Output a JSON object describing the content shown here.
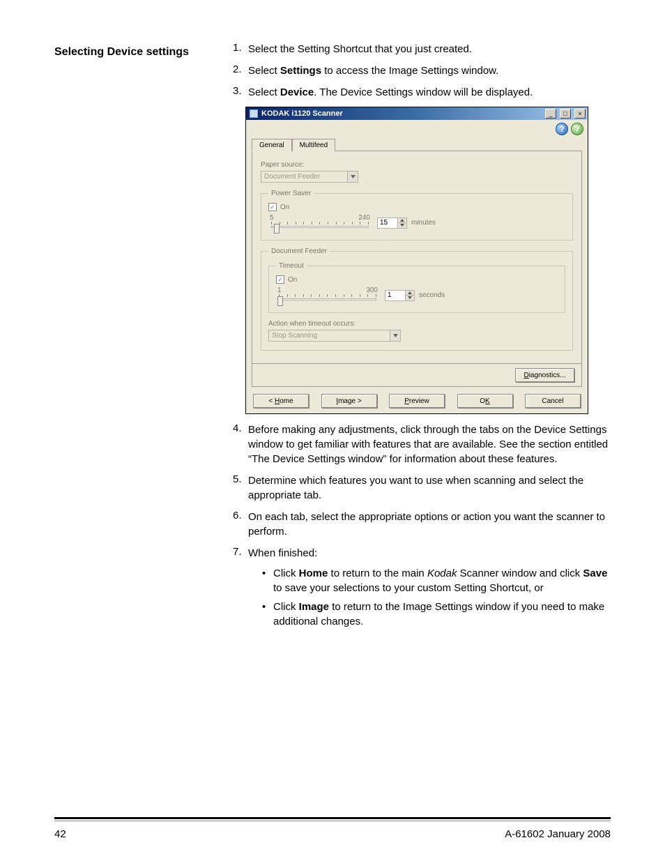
{
  "heading": "Selecting Device settings",
  "steps": {
    "s1_num": "1.",
    "s1": "Select the Setting Shortcut that you just created.",
    "s2_num": "2.",
    "s2a": "Select ",
    "s2b": "Settings",
    "s2c": " to access the Image Settings window.",
    "s3_num": "3.",
    "s3a": "Select ",
    "s3b": "Device",
    "s3c": ". The Device Settings window will be displayed.",
    "s4_num": "4.",
    "s4": "Before making any adjustments, click through the tabs on the Device Settings window to get familiar with features that are available. See the section entitled “The Device Settings window” for information about these features.",
    "s5_num": "5.",
    "s5": "Determine which features you want to use when scanning and select the appropriate tab.",
    "s6_num": "6.",
    "s6": "On each tab, select the appropriate options or action you want the scanner to perform.",
    "s7_num": "7.",
    "s7": "When finished:",
    "b1a": "Click ",
    "b1b": "Home",
    "b1c": " to return to the main ",
    "b1d": "Kodak",
    "b1e": " Scanner window and click ",
    "b1f": "Save",
    "b1g": " to save your selections to your custom Setting Shortcut, or",
    "b2a": "Click ",
    "b2b": "Image",
    "b2c": " to return to the Image Settings window if you need to make additional changes."
  },
  "ui": {
    "title": "KODAK i1120 Scanner",
    "win_min": "_",
    "win_max": "□",
    "win_close": "×",
    "help_globe": "?",
    "help_q": "?",
    "tab_general": "General",
    "tab_multifeed": "Multifeed",
    "paper_source_label": "Paper source:",
    "paper_source_value": "Document Feeder",
    "power_saver_legend": "Power Saver",
    "ps_on": "On",
    "ps_min": "5",
    "ps_max": "240",
    "ps_value": "15",
    "ps_unit": "minutes",
    "doc_feeder_legend": "Document Feeder",
    "timeout_legend": "Timeout",
    "to_on": "On",
    "to_min": "1",
    "to_max": "300",
    "to_value": "1",
    "to_unit": "seconds",
    "action_label": "Action when timeout occurs:",
    "action_value": "Stop Scanning",
    "diagnostics": "Diagnostics...",
    "diagnostics_u": "D",
    "btn_home_pre": "< ",
    "btn_home_u": "H",
    "btn_home_post": "ome",
    "btn_image_u": "I",
    "btn_image_post": "mage >",
    "btn_preview_u": "P",
    "btn_preview_post": "review",
    "btn_ok": "O",
    "btn_ok_u": "K",
    "btn_cancel": "Cancel"
  },
  "footer": {
    "page": "42",
    "doc": "A-61602  January 2008"
  }
}
